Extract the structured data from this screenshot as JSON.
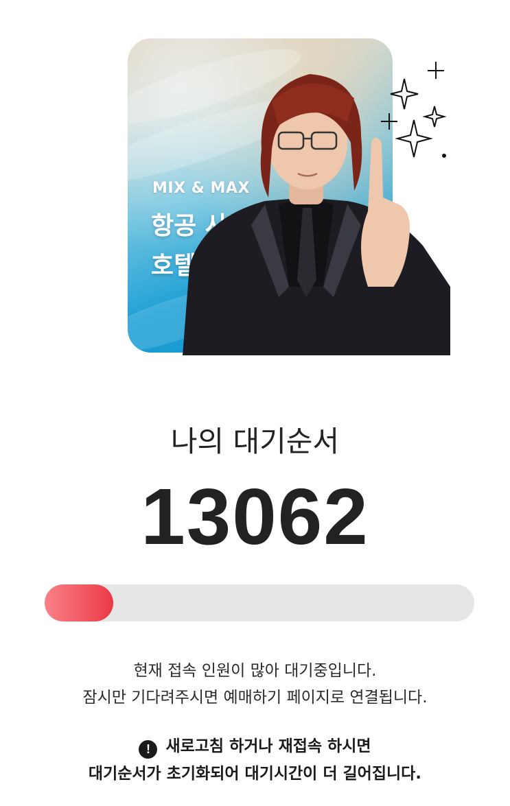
{
  "banner": {
    "brand": "MIX & MAX",
    "headline_line1": "항공 사면",
    "headline_line2": "호텔 할인!"
  },
  "queue": {
    "label": "나의 대기순서",
    "number": "13062",
    "progress_fraction": 0.16
  },
  "notice": {
    "line1": "현재 접속 인원이 많아 대기중입니다.",
    "line2": "잠시만 기다려주시면 예매하기 페이지로 연결됩니다."
  },
  "warning": {
    "icon": "exclamation-circle-icon",
    "line1": "새로고침 하거나 재접속 하시면",
    "line2": "대기순서가 초기화되어 대기시간이 더 길어집니다."
  },
  "colors": {
    "progress_fill": "#ef5059",
    "progress_track": "#e6e6e6",
    "text": "#222222"
  }
}
